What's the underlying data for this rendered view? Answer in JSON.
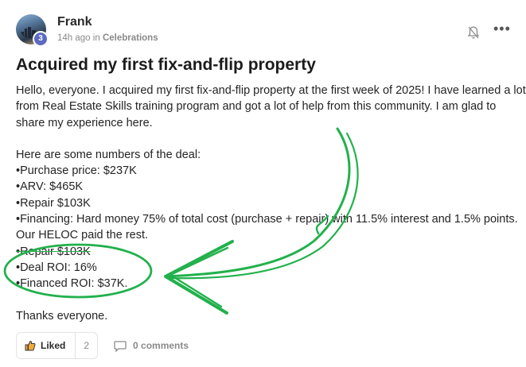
{
  "post": {
    "author": "Frank",
    "avatar_level": "3",
    "time": "14h ago",
    "in_word": "in",
    "category": "Celebrations",
    "title": "Acquired my first fix-and-flip property",
    "intro_lines": [
      "Hello, everyone. I acquired my first fix-and-flip property at the first week of 2025! I have learned a lot",
      "from Real Estate Skills training program and got a lot of help from this community. I am glad to",
      "share my experience here."
    ],
    "deal_lines": [
      "Here are some numbers of the deal:",
      "•Purchase price: $237K",
      "•ARV: $465K",
      "•Repair $103K",
      "•Financing: Hard money 75% of total cost (purchase + repair) with 11.5% interest and 1.5% points.",
      "Our HELOC paid the rest.",
      "•Repair $103K",
      "•Deal ROI: 16%",
      "•Financed ROI: $37K."
    ],
    "closing": "Thanks everyone."
  },
  "footer": {
    "like_label": "Liked",
    "like_count": "2",
    "comments_label": "0 comments"
  },
  "icons": {
    "avatar": "avatar-image",
    "bell": "bell-off-icon",
    "more": "more-options-icon",
    "like": "thumbs-up-icon",
    "comment": "comment-icon"
  },
  "colors": {
    "annotation": "#22b14c",
    "level_badge": "#5c6bc0",
    "muted_text": "#8a8a8a"
  },
  "more_glyph": "•••"
}
